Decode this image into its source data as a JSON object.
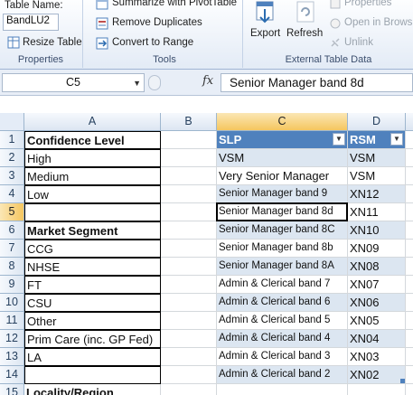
{
  "ribbon": {
    "properties": {
      "table_name_label": "Table Name:",
      "table_name_value": "BandLU2",
      "resize_label": "Resize Table",
      "group_label": "Properties"
    },
    "tools": {
      "summarize_label": "Summarize with PivotTable",
      "remove_duplicates_label": "Remove Duplicates",
      "convert_label": "Convert to Range",
      "group_label": "Tools"
    },
    "external": {
      "export_label": "Export",
      "refresh_label": "Refresh",
      "properties_label": "Properties",
      "open_browser_label": "Open in Brows",
      "unlink_label": "Unlink",
      "group_label": "External Table Data"
    }
  },
  "formula_bar": {
    "name_box": "C5",
    "fx_label": "fx",
    "content": "Senior Manager band 8d"
  },
  "sheet": {
    "columns": [
      "A",
      "B",
      "C",
      "D"
    ],
    "rows": [
      {
        "n": "1",
        "a": "Confidence Level",
        "c": "SLP",
        "d": "RSM"
      },
      {
        "n": "2",
        "a": "High",
        "c": "VSM",
        "d": "VSM"
      },
      {
        "n": "3",
        "a": "Medium",
        "c": "Very Senior Manager",
        "d": "VSM"
      },
      {
        "n": "4",
        "a": "Low",
        "c": "Senior Manager band 9",
        "d": "XN12"
      },
      {
        "n": "5",
        "a": "",
        "c": "Senior Manager band 8d",
        "d": "XN11"
      },
      {
        "n": "6",
        "a": "Market Segment",
        "c": "Senior Manager band 8C",
        "d": "XN10"
      },
      {
        "n": "7",
        "a": "CCG",
        "c": "Senior Manager band 8b",
        "d": "XN09"
      },
      {
        "n": "8",
        "a": "NHSE",
        "c": "Senior Manager band 8A",
        "d": "XN08"
      },
      {
        "n": "9",
        "a": "FT",
        "c": "Admin & Clerical band 7",
        "d": "XN07"
      },
      {
        "n": "10",
        "a": "CSU",
        "c": "Admin & Clerical band 6",
        "d": "XN06"
      },
      {
        "n": "11",
        "a": "Other",
        "c": "Admin & Clerical band 5",
        "d": "XN05"
      },
      {
        "n": "12",
        "a": "Prim Care (inc. GP Fed)",
        "c": "Admin & Clerical band 4",
        "d": "XN04"
      },
      {
        "n": "13",
        "a": "LA",
        "c": "Admin & Clerical band 3",
        "d": "XN03"
      },
      {
        "n": "14",
        "a": "",
        "c": "Admin & Clerical band 2",
        "d": "XN02"
      },
      {
        "n": "15",
        "a": "Locality/Region",
        "c": "",
        "d": ""
      }
    ],
    "active_cell": "C5"
  }
}
